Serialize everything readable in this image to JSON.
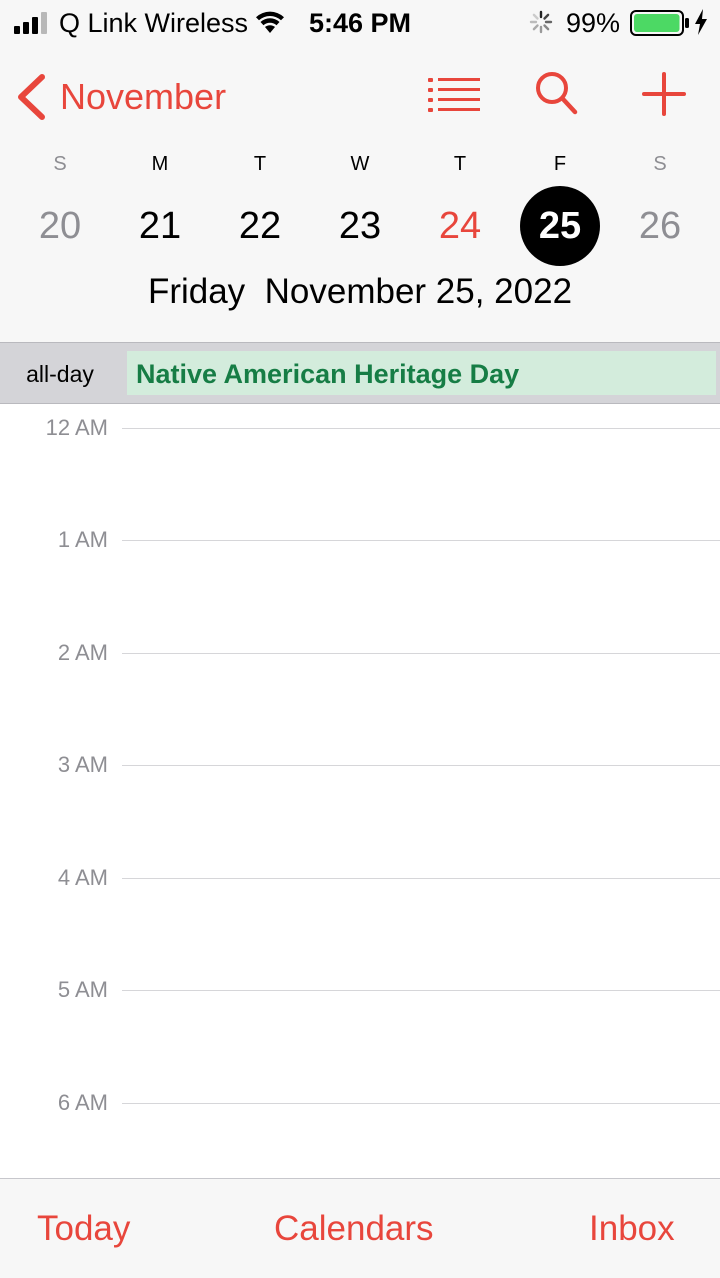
{
  "status_bar": {
    "carrier": "Q Link Wireless",
    "time": "5:46 PM",
    "battery_percent": "99%",
    "battery_level": 0.99,
    "icons": [
      "signal-bars-icon",
      "wifi-icon",
      "activity-spinner-icon",
      "battery-icon",
      "charging-bolt-icon"
    ]
  },
  "header": {
    "back_label": "November",
    "icons": [
      "chevron-left-icon",
      "list-icon",
      "search-icon",
      "plus-icon"
    ],
    "accent_color": "#e8463c"
  },
  "week": {
    "weekdays": [
      "S",
      "M",
      "T",
      "W",
      "T",
      "F",
      "S"
    ],
    "days": [
      "20",
      "21",
      "22",
      "23",
      "24",
      "25",
      "26"
    ],
    "today": "24",
    "selected": "25"
  },
  "selected_date": {
    "weekday": "Friday",
    "date": "November 25, 2022",
    "caption": "Friday  November 25, 2022"
  },
  "all_day": {
    "label": "all-day",
    "event_title": "Native American Heritage Day",
    "event_color": "#167d45",
    "event_bg": "#d3ecdc"
  },
  "timeline": {
    "hours": [
      "12 AM",
      "1 AM",
      "2 AM",
      "3 AM",
      "4 AM",
      "5 AM",
      "6 AM"
    ]
  },
  "tab_bar": {
    "today": "Today",
    "calendars": "Calendars",
    "inbox": "Inbox"
  }
}
